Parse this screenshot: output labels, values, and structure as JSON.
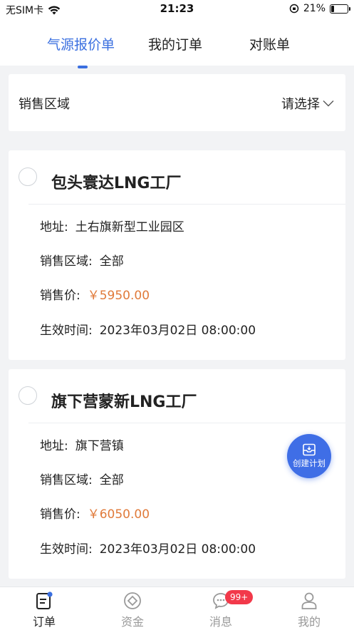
{
  "status_bar": {
    "carrier": "无SIM卡",
    "time": "21:23",
    "battery": "21%",
    "battery_level": 0.21
  },
  "tabs": [
    {
      "label": "气源报价单",
      "active": true
    },
    {
      "label": "我的订单",
      "active": false
    },
    {
      "label": "对账单",
      "active": false
    }
  ],
  "filter": {
    "region_label": "销售区域",
    "region_select": "请选择"
  },
  "cards": [
    {
      "name": "包头寰达LNG工厂",
      "address_label": "地址:",
      "address": "土右旗新型工业园区",
      "region_label": "销售区域:",
      "region": "全部",
      "price_label": "销售价:",
      "price": "￥5950.00",
      "time_label": "生效时间:",
      "time": "2023年03月02日 08:00:00"
    },
    {
      "name": "旗下营蒙新LNG工厂",
      "address_label": "地址:",
      "address": "旗下营镇",
      "region_label": "销售区域:",
      "region": "全部",
      "price_label": "销售价:",
      "price": "￥6050.00",
      "time_label": "生效时间:",
      "time": "2023年03月02日 08:00:00"
    }
  ],
  "fab": {
    "label": "创建计划",
    "icon": "create-plan-icon"
  },
  "bottom_nav": [
    {
      "label": "订单",
      "icon": "order-icon",
      "active": true
    },
    {
      "label": "资金",
      "icon": "fund-icon",
      "active": false
    },
    {
      "label": "消息",
      "icon": "message-icon",
      "active": false,
      "badge": "99+"
    },
    {
      "label": "我的",
      "icon": "profile-icon",
      "active": false
    }
  ],
  "colors": {
    "accent": "#3a6fe0",
    "price": "#e07a3a",
    "badge": "#f2394a",
    "background": "#f2f3f5"
  }
}
